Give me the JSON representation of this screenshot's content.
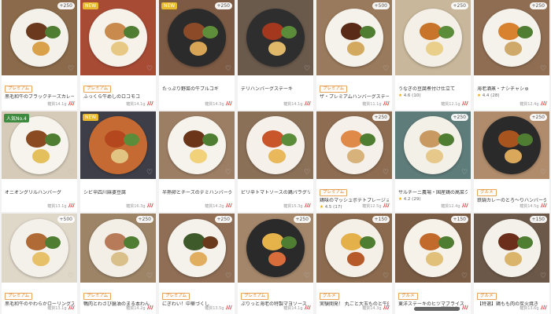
{
  "cards": [
    {
      "name": "黒毛和牛のブラックチーズカレー",
      "tag": "プレミアム",
      "badge": "",
      "price": "+250",
      "rating": "",
      "label": "糖質14.1g",
      "heat": "ﾉﾉﾉ",
      "bg": "#8a6a4a",
      "plate": "#f4f1ea",
      "foods": [
        "#6b3a1e",
        "#4f7d32",
        "#d9a14a"
      ]
    },
    {
      "name": "ふっくら牛めしのロコモコ",
      "tag": "プレミアム",
      "badge": "NEW",
      "price": "",
      "rating": "",
      "label": "糖質14.1g",
      "heat": "ﾉﾉﾉ",
      "bg": "#a84b35",
      "plate": "#f6f2ea",
      "foods": [
        "#c98a4e",
        "#4f7d32",
        "#e7c884"
      ]
    },
    {
      "name": "たっぷり野菜の牛プルコギ",
      "tag": "",
      "badge": "NEW",
      "price": "+250",
      "rating": "",
      "label": "糖質14.3g",
      "heat": "ﾉﾉﾉ",
      "bg": "#7c5a44",
      "plate": "#2b2b2b",
      "foods": [
        "#8c4a28",
        "#5f8e3a",
        "#d7a555"
      ]
    },
    {
      "name": "デリハンバーグステーキ",
      "tag": "",
      "badge": "",
      "price": "",
      "rating": "",
      "label": "糖質14.1g",
      "heat": "ﾉﾉﾉ",
      "bg": "#6a5a4c",
      "plate": "#2e2e2e",
      "foods": [
        "#a3381f",
        "#5b8c3a",
        "#e0b869"
      ]
    },
    {
      "name": "ザ・プレミアムハンバーグステーキ",
      "tag": "プレミアム",
      "badge": "",
      "price": "+500",
      "rating": "",
      "label": "糖質11.1g",
      "heat": "ﾉﾉﾉ",
      "bg": "#9a7a5c",
      "plate": "#f5f2ec",
      "foods": [
        "#5a2a18",
        "#4f7d32",
        "#d3a960"
      ]
    },
    {
      "name": "うなぎの豆腐煮付け仕立て",
      "tag": "",
      "badge": "",
      "price": "+250",
      "rating": "4.6 (10)",
      "label": "糖質12.1g",
      "heat": "ﾉﾉﾉ",
      "bg": "#c8b79a",
      "plate": "#f4f0e7",
      "foods": [
        "#c8742a",
        "#5b8c3a",
        "#e9cf8a"
      ]
    },
    {
      "name": "海老酒蒸・ナシチャシゅ",
      "tag": "",
      "badge": "",
      "price": "+250",
      "rating": "4.4 (28)",
      "label": "糖質12.4g",
      "heat": "ﾉﾉﾉ",
      "bg": "#8f6d52",
      "plate": "#f5f2ec",
      "foods": [
        "#d8812f",
        "#4f7d32",
        "#cfa96a"
      ]
    },
    {
      "name": "オニオングリルハンバーグ",
      "tag": "",
      "badge": "人気No.4",
      "price": "",
      "rating": "",
      "label": "糖質13.1g",
      "heat": "ﾉﾉﾉ",
      "bg": "#d6cbb8",
      "plate": "#f7f4ee",
      "foods": [
        "#8a4b22",
        "#4f7d32",
        "#e3c05b"
      ]
    },
    {
      "name": "シビ辛四川麻婆豆腐",
      "tag": "",
      "badge": "NEW",
      "price": "",
      "rating": "",
      "label": "糖質16.3g",
      "heat": "ﾉﾉﾉ",
      "bg": "#3e3e48",
      "plate": "#c56a33",
      "foods": [
        "#b5471f",
        "#5b8c3a",
        "#e2c482"
      ]
    },
    {
      "name": "半熟卵とチーズのデミハンバーグ",
      "tag": "",
      "badge": "",
      "price": "",
      "rating": "",
      "label": "糖質14.2g",
      "heat": "ﾉﾉﾉ",
      "bg": "#9c7e64",
      "plate": "#f6f3ed",
      "foods": [
        "#6b351a",
        "#4f7d32",
        "#f1d27a"
      ]
    },
    {
      "name": "ピリ辛トマトソースの鶏パラグリル",
      "tag": "",
      "badge": "",
      "price": "",
      "rating": "",
      "label": "糖質15.3g",
      "heat": "ﾉﾉﾉ",
      "bg": "#8b7058",
      "plate": "#f5f1ea",
      "foods": [
        "#c9552a",
        "#5b8c3a",
        "#e8b85a"
      ]
    },
    {
      "name": "鶏味のマッシュポテトプレージョ",
      "tag": "プレミアム",
      "badge": "",
      "price": "+250",
      "rating": "4.5 (17)",
      "label": "糖質12.5g",
      "heat": "ﾉﾉﾉ",
      "bg": "#8e6c51",
      "plate": "#f5f1ea",
      "foods": [
        "#e08a4a",
        "#4f7d32",
        "#d7b27a"
      ]
    },
    {
      "name": "サルチーニ農場・国産鶏の高菜クリーム仕立て",
      "tag": "",
      "badge": "",
      "price": "+250",
      "rating": "4.2 (29)",
      "label": "糖質12.4g",
      "heat": "ﾉﾉﾉ",
      "bg": "#5e7c7a",
      "plate": "#f3f0e8",
      "foods": [
        "#c89a62",
        "#4f7d32",
        "#e6c98a"
      ]
    },
    {
      "name": "鉄鍋カレーのとろ〜りハンバーグ",
      "tag": "グルメ",
      "badge": "",
      "price": "+250",
      "rating": "",
      "label": "糖質14.5g",
      "heat": "ﾉﾉﾉ",
      "bg": "#b08c6c",
      "plate": "#2a2a2a",
      "foods": [
        "#a8541f",
        "#4f7d32",
        "#d9a85a"
      ]
    },
    {
      "name": "黒毛和牛のやわらかローリングステーキ",
      "tag": "プレミアム",
      "badge": "",
      "price": "+500",
      "rating": "",
      "label": "糖質13.1g",
      "heat": "ﾉﾉﾉ",
      "bg": "#dfd7c8",
      "plate": "#f4f1ea",
      "foods": [
        "#b06a36",
        "#4f7d32",
        "#e7c06a"
      ]
    },
    {
      "name": "鴨肉とわさび醤油のまる本わん",
      "tag": "プレミアム",
      "badge": "",
      "price": "+250",
      "rating": "",
      "label": "糖質14.2g",
      "heat": "ﾉﾉﾉ",
      "bg": "#9d8467",
      "plate": "#f3efe7",
      "foods": [
        "#b77b5a",
        "#4f7d32",
        "#d9c08a"
      ]
    },
    {
      "name": "にぎわい！中華づくし",
      "tag": "プレミアム",
      "badge": "",
      "price": "+250",
      "rating": "",
      "label": "糖質13.5g",
      "heat": "ﾉﾉﾉ",
      "bg": "#8f6e55",
      "plate": "#f5f2ec",
      "foods": [
        "#3f5a2a",
        "#6a3a1c",
        "#e0ae5e"
      ]
    },
    {
      "name": "ぷりっと海老の特製マヨソース",
      "tag": "プレミアム",
      "badge": "",
      "price": "+250",
      "rating": "",
      "label": "糖質14.1g",
      "heat": "ﾉﾉﾉ",
      "bg": "#a4876b",
      "plate": "#2a2a2a",
      "foods": [
        "#e6b24a",
        "#4f7d32",
        "#d86c3a"
      ]
    },
    {
      "name": "実験開発！ 丸ごと大玉ものと牛肉の煮",
      "tag": "グルメ",
      "badge": "",
      "price": "+150",
      "rating": "",
      "label": "糖質14.3g",
      "heat": "ﾉﾉﾉ",
      "bg": "#8b6a4e",
      "plate": "#f4f0e7",
      "foods": [
        "#e3b04a",
        "#4f7d32",
        "#b65a2a"
      ]
    },
    {
      "name": "東洋ステーキのヒツマブライス",
      "tag": "グルメ",
      "badge": "",
      "price": "+150",
      "rating": "",
      "label": "糖質14.8g",
      "heat": "ﾉﾉﾉ",
      "bg": "#7a5c44",
      "plate": "#f6f2ea",
      "foods": [
        "#c26a2c",
        "#4f7d32",
        "#e1c07a"
      ]
    },
    {
      "name": "【特選】鶏もも肉の炭火焼き",
      "tag": "グルメ",
      "badge": "",
      "price": "+150",
      "rating": "",
      "label": "糖質13.6g",
      "heat": "ﾉﾉﾉ",
      "bg": "#6b5848",
      "plate": "#f4f1ea",
      "foods": [
        "#6b2e1a",
        "#4f7d32",
        "#d9b46a"
      ]
    }
  ]
}
